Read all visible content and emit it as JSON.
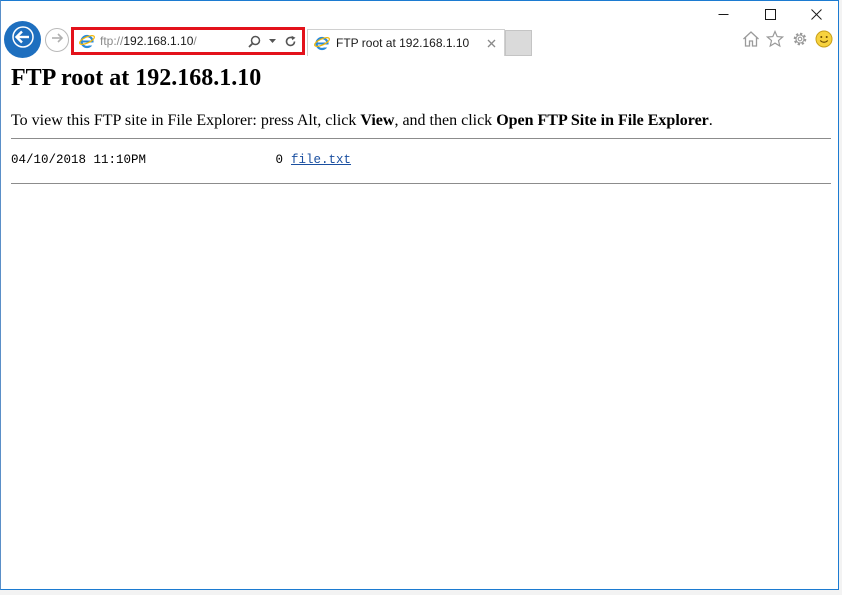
{
  "window": {
    "caption": {
      "minimize_icon": "minimize-icon",
      "maximize_icon": "maximize-icon",
      "close_icon": "close-icon"
    }
  },
  "navigation": {
    "back_icon": "back-arrow-icon",
    "forward_icon": "forward-arrow-icon"
  },
  "address_bar": {
    "protocol": "ftp://",
    "host": "192.168.1.10",
    "tail": "/",
    "icons": [
      "ie-logo-icon",
      "search-icon",
      "dropdown-icon",
      "refresh-icon"
    ]
  },
  "tabs": [
    {
      "title": "FTP root at 192.168.1.10",
      "active": true
    }
  ],
  "toolbar": {
    "icons": [
      "home-icon",
      "favorites-star-icon",
      "settings-gear-icon",
      "feedback-smiley-icon"
    ]
  },
  "page": {
    "title": "FTP root at 192.168.1.10",
    "instructions": {
      "prefix": "To view this FTP site in File Explorer: press Alt, click ",
      "view": "View",
      "middle": ", and then click ",
      "open_label": "Open FTP Site in File Explorer",
      "suffix": "."
    },
    "listing": [
      {
        "date": "04/10/2018 11:10PM",
        "size": "0",
        "name": "file.txt"
      }
    ]
  },
  "colors": {
    "highlight": "#e3121b",
    "accent": "#1e6fbf",
    "link": "#1a4fa0"
  }
}
